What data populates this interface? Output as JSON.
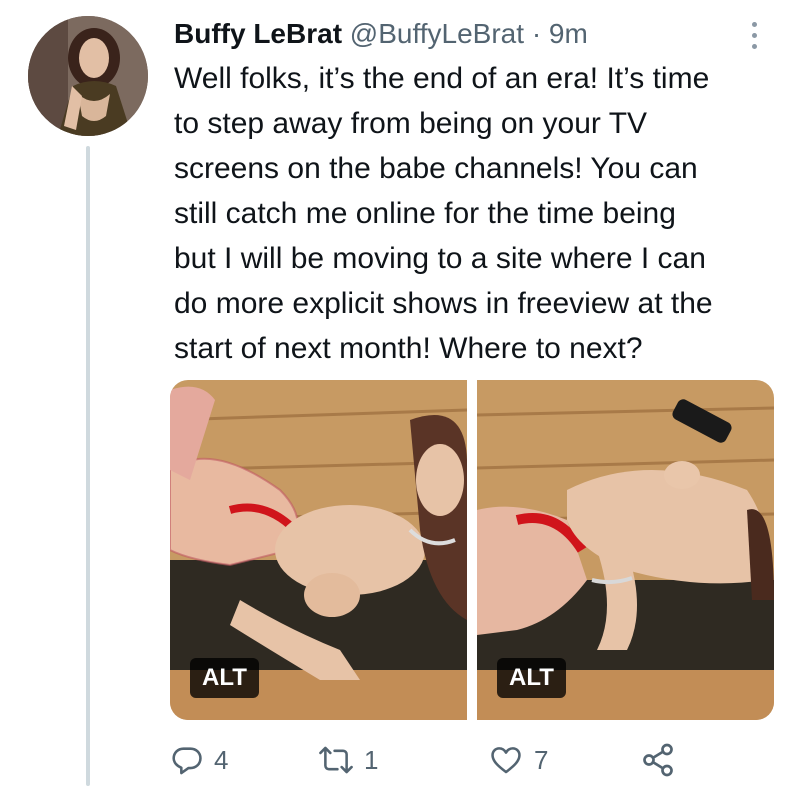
{
  "tweet": {
    "author_name": "Buffy LeBrat",
    "handle": "@BuffyLeBrat",
    "separator": "·",
    "time": "9m",
    "text": "Well folks, it’s the end of an era! It’s time\nto step away from being on your TV\nscreens on the babe channels! You can\nstill catch me online for the time being\nbut I will be moving to a site where I can\ndo more explicit shows in freeview at the\nstart of next month! Where to next?",
    "media": [
      {
        "alt_label": "ALT"
      },
      {
        "alt_label": "ALT"
      }
    ],
    "actions": {
      "reply_icon": "reply-icon",
      "reply_count": "4",
      "retweet_icon": "retweet-icon",
      "retweet_count": "1",
      "like_icon": "like-icon",
      "like_count": "7",
      "share_icon": "share-icon"
    }
  },
  "colors": {
    "text": "#0f1419",
    "secondary": "#536471",
    "thread_line": "#cfd9de",
    "wood": "#c79a63",
    "mat": "#2f2a22",
    "skin": "#e7c3a7",
    "lingerie": "#d0141b"
  }
}
